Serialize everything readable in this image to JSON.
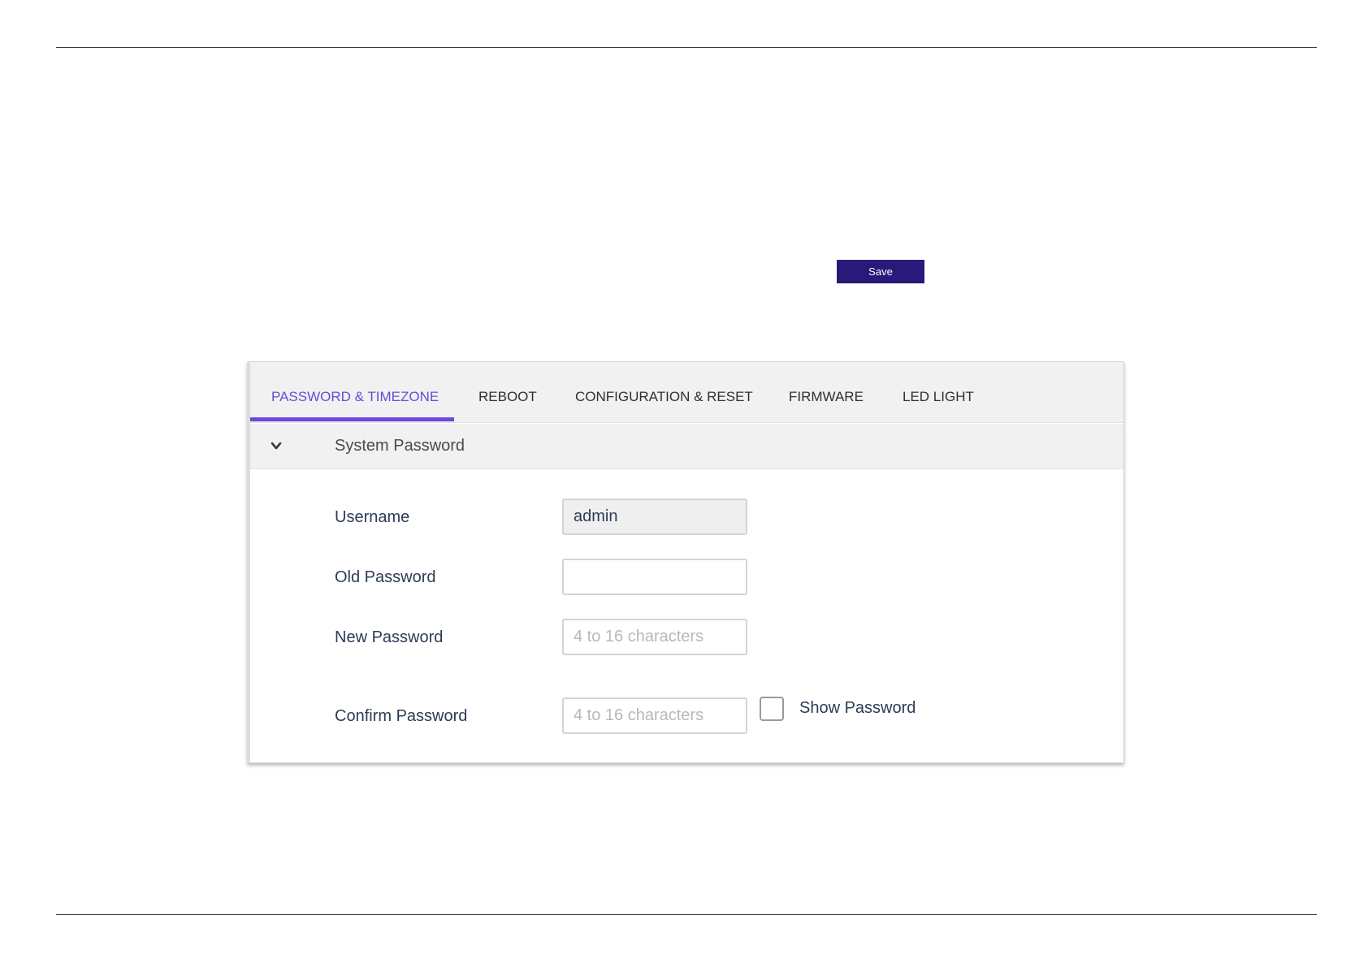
{
  "toolbar": {
    "save_label": "Save"
  },
  "tabs": [
    {
      "label": "PASSWORD & TIMEZONE",
      "active": true
    },
    {
      "label": "REBOOT",
      "active": false
    },
    {
      "label": "CONFIGURATION & RESET",
      "active": false
    },
    {
      "label": "FIRMWARE",
      "active": false
    },
    {
      "label": "LED LIGHT",
      "active": false
    }
  ],
  "section": {
    "title": "System Password",
    "expanded": true,
    "icon": "chevron-down-icon"
  },
  "form": {
    "username": {
      "label": "Username",
      "value": "admin"
    },
    "old_password": {
      "label": "Old Password",
      "value": ""
    },
    "new_password": {
      "label": "New Password",
      "placeholder": "4 to 16 characters"
    },
    "confirm_password": {
      "label": "Confirm Password",
      "placeholder": "4 to 16 characters"
    },
    "show_password": {
      "label": "Show Password",
      "checked": false
    }
  },
  "colors": {
    "accent": "#6a48e0",
    "save_button": "#271a7a",
    "label_text": "#2e3b55"
  }
}
